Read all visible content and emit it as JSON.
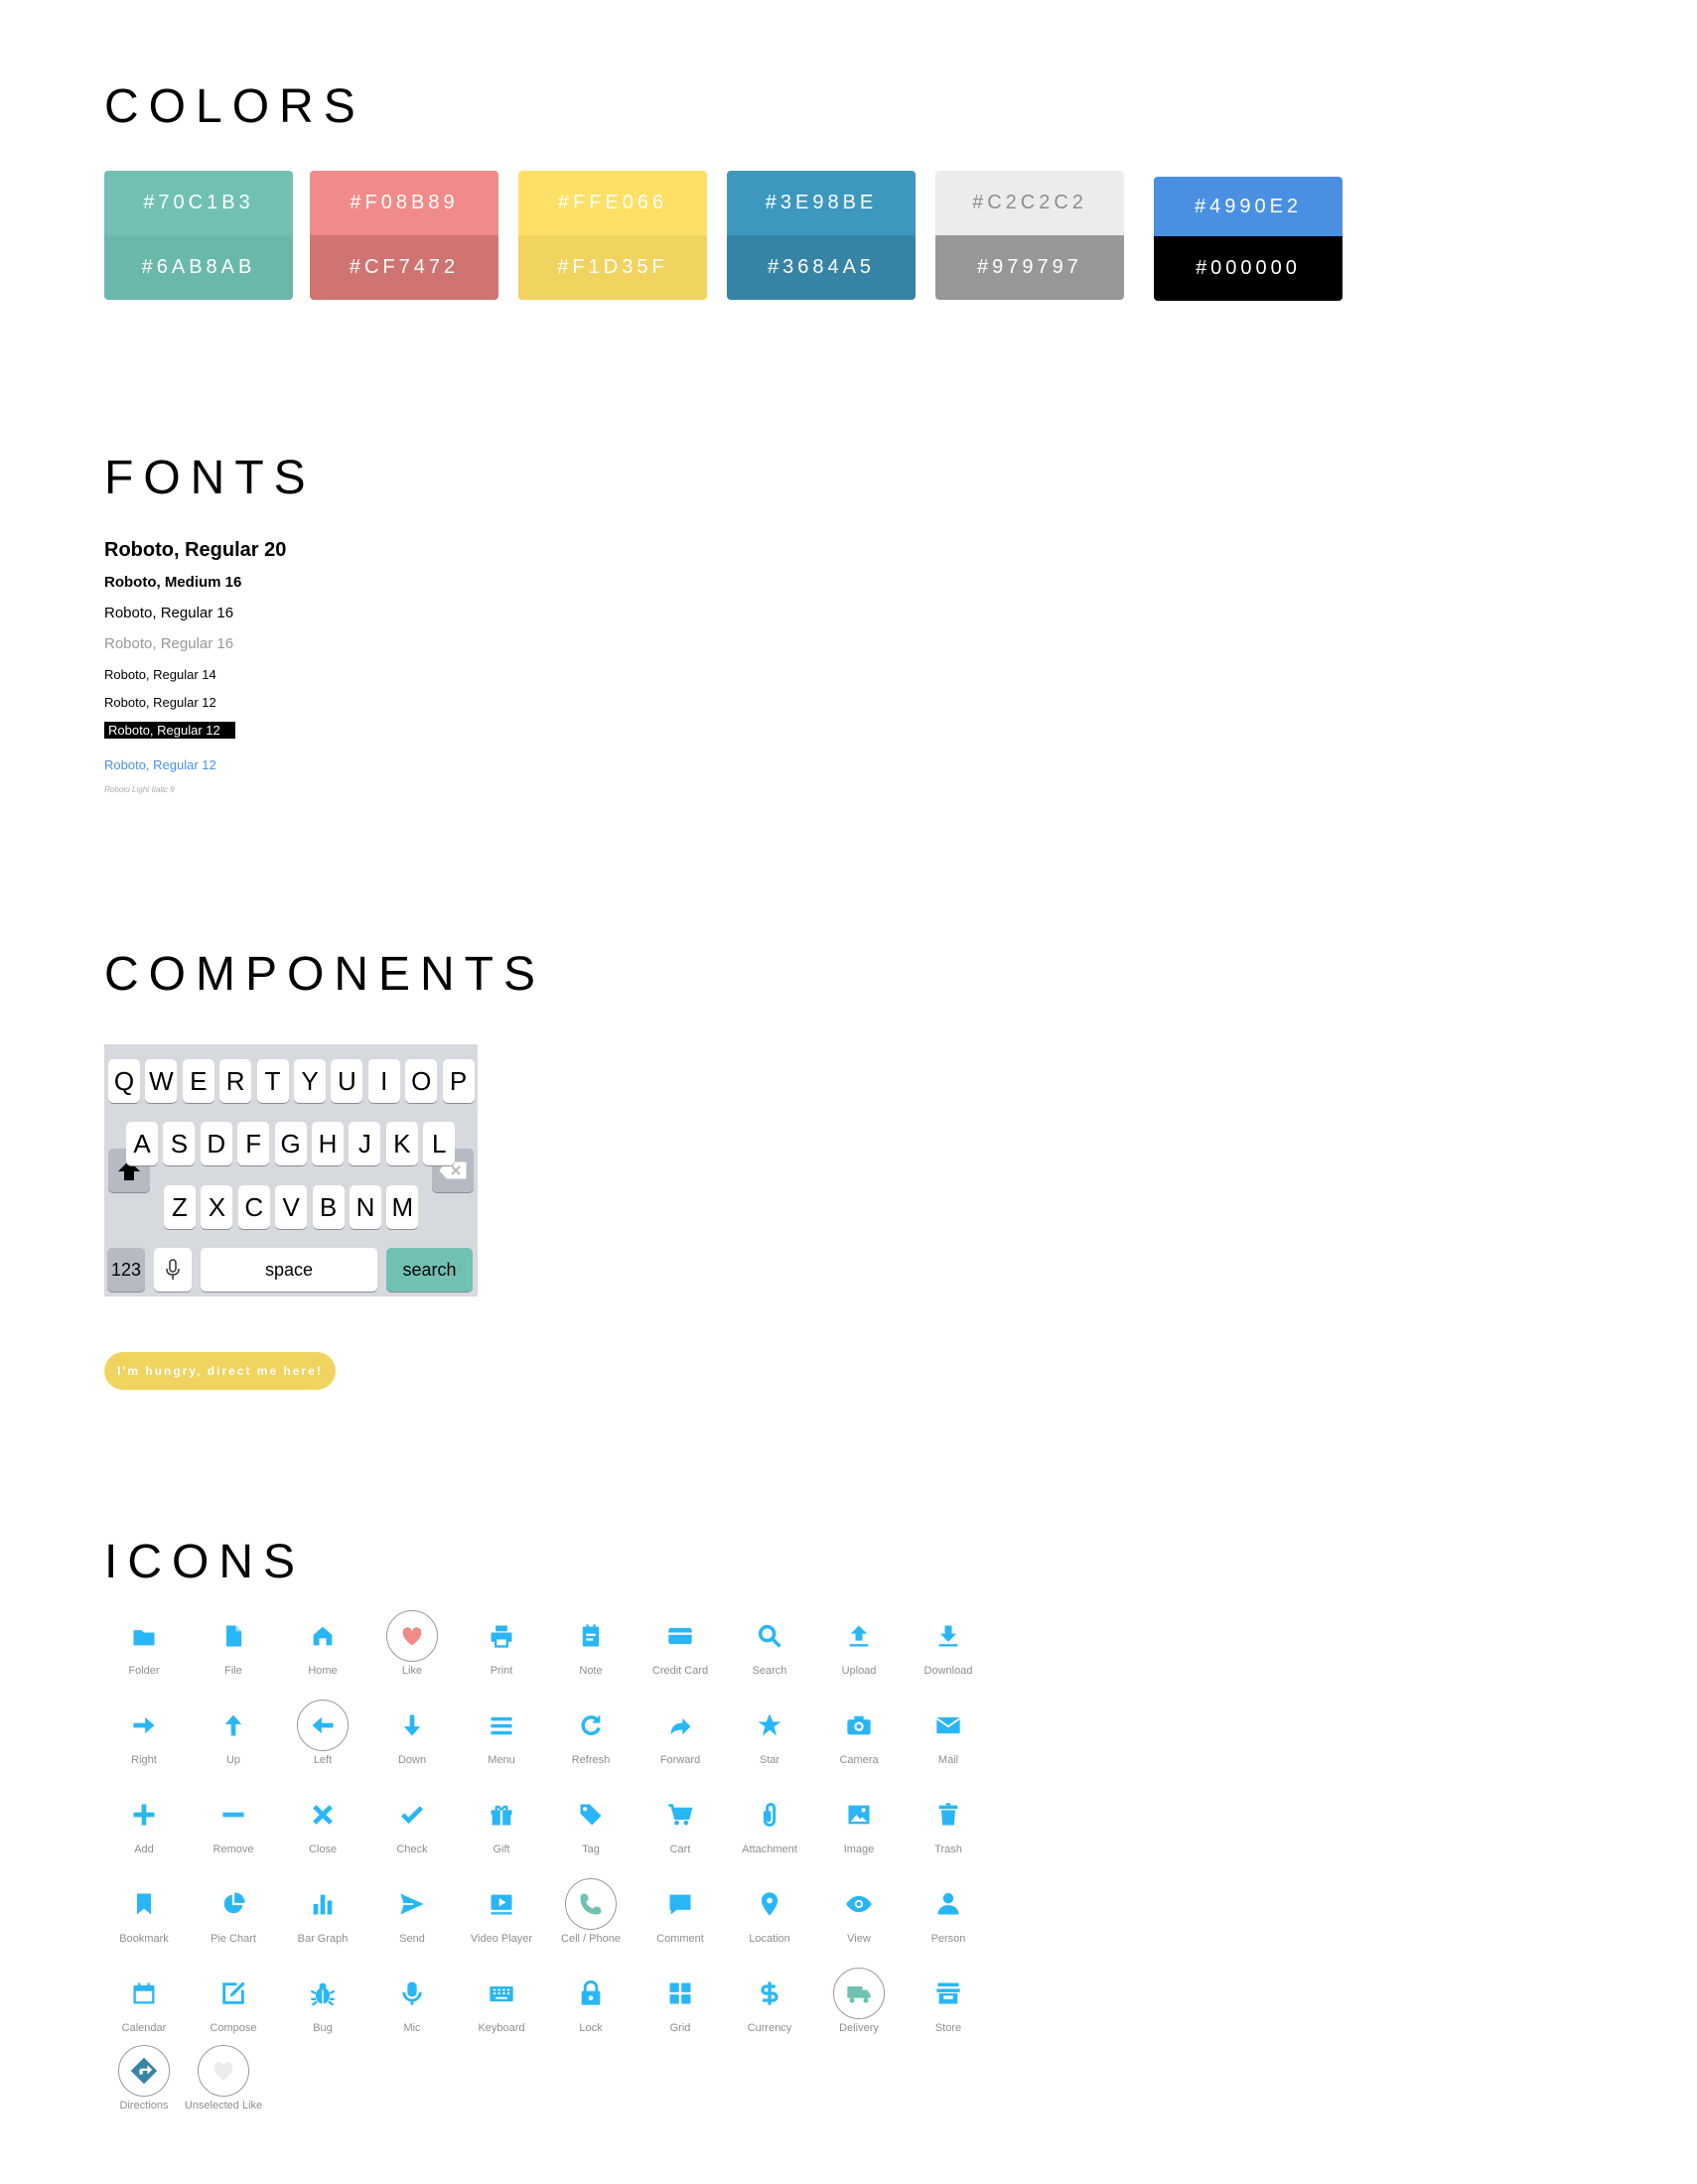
{
  "colors": {
    "title": "COLORS",
    "swatches": [
      {
        "top": "#70C1B3",
        "bottom": "#6AB8AB",
        "top_color": "#70c1b3",
        "bottom_color": "#6ab8ab",
        "top_text_color": "#ffffff"
      },
      {
        "top": "#F08B89",
        "bottom": "#CF7472",
        "top_color": "#f08b89",
        "bottom_color": "#cf7472",
        "top_text_color": "#ffffff"
      },
      {
        "top": "#FFE066",
        "bottom": "#F1D35F",
        "top_color": "#ffe066",
        "bottom_color": "#f1d35f",
        "top_text_color": "#ffffff"
      },
      {
        "top": "#3E98BE",
        "bottom": "#3684A5",
        "top_color": "#3e98be",
        "bottom_color": "#3684a5",
        "top_text_color": "#ffffff"
      },
      {
        "top": "#C2C2C2",
        "bottom": "#979797",
        "top_color": "#ececec",
        "bottom_color": "#979797",
        "top_text_color": "#8e8e8e"
      },
      {
        "top": "#4990E2",
        "bottom": "#000000",
        "top_color": "#4990e2",
        "bottom_color": "#000000",
        "top_text_color": "#ffffff"
      }
    ]
  },
  "fonts": {
    "title": "FONTS",
    "samples": [
      "Roboto, Regular 20",
      "Roboto, Medium 16",
      "Roboto, Regular 16",
      "Roboto, Regular 16",
      "Roboto, Regular 14",
      "Roboto, Regular 12",
      "Roboto, Regular 12",
      "Roboto, Regular 12",
      "Roboto Light Italic 9"
    ]
  },
  "components": {
    "title": "COMPONENTS",
    "keyboard": {
      "row1": [
        "Q",
        "W",
        "E",
        "R",
        "T",
        "Y",
        "U",
        "I",
        "O",
        "P"
      ],
      "row2": [
        "A",
        "S",
        "D",
        "F",
        "G",
        "H",
        "J",
        "K",
        "L"
      ],
      "row3": [
        "Z",
        "X",
        "C",
        "V",
        "B",
        "N",
        "M"
      ],
      "numbers_key": "123",
      "space_key": "space",
      "search_key": "search",
      "search_key_color": "#70c1b3"
    },
    "pill_button": "I'm hungry, direct me here!"
  },
  "icons": {
    "title": "ICONS",
    "accent": "#29b6f6",
    "items": [
      {
        "label": "Folder",
        "icon": "folder-icon"
      },
      {
        "label": "File",
        "icon": "file-icon"
      },
      {
        "label": "Home",
        "icon": "home-icon"
      },
      {
        "label": "Like",
        "icon": "heart-icon"
      },
      {
        "label": "Print",
        "icon": "printer-icon"
      },
      {
        "label": "Note",
        "icon": "note-icon"
      },
      {
        "label": "Credit Card",
        "icon": "credit-card-icon"
      },
      {
        "label": "Search",
        "icon": "search-icon"
      },
      {
        "label": "Upload",
        "icon": "upload-icon"
      },
      {
        "label": "Download",
        "icon": "download-icon"
      },
      {
        "label": "Right",
        "icon": "arrow-right-icon"
      },
      {
        "label": "Up",
        "icon": "arrow-up-icon"
      },
      {
        "label": "Left",
        "icon": "arrow-left-icon"
      },
      {
        "label": "Down",
        "icon": "arrow-down-icon"
      },
      {
        "label": "Menu",
        "icon": "menu-icon"
      },
      {
        "label": "Refresh",
        "icon": "refresh-icon"
      },
      {
        "label": "Forward",
        "icon": "forward-icon"
      },
      {
        "label": "Star",
        "icon": "star-icon"
      },
      {
        "label": "Camera",
        "icon": "camera-icon"
      },
      {
        "label": "Mail",
        "icon": "mail-icon"
      },
      {
        "label": "Add",
        "icon": "plus-icon"
      },
      {
        "label": "Remove",
        "icon": "minus-icon"
      },
      {
        "label": "Close",
        "icon": "close-icon"
      },
      {
        "label": "Check",
        "icon": "check-icon"
      },
      {
        "label": "Gift",
        "icon": "gift-icon"
      },
      {
        "label": "Tag",
        "icon": "tag-icon"
      },
      {
        "label": "Cart",
        "icon": "cart-icon"
      },
      {
        "label": "Attachment",
        "icon": "paperclip-icon"
      },
      {
        "label": "Image",
        "icon": "image-icon"
      },
      {
        "label": "Trash",
        "icon": "trash-icon"
      },
      {
        "label": "Bookmark",
        "icon": "bookmark-icon"
      },
      {
        "label": "Pie Chart",
        "icon": "pie-chart-icon"
      },
      {
        "label": "Bar Graph",
        "icon": "bar-graph-icon"
      },
      {
        "label": "Send",
        "icon": "send-icon"
      },
      {
        "label": "Video Player",
        "icon": "video-player-icon"
      },
      {
        "label": "Cell / Phone",
        "icon": "phone-icon"
      },
      {
        "label": "Comment",
        "icon": "comment-icon"
      },
      {
        "label": "Location",
        "icon": "location-pin-icon"
      },
      {
        "label": "View",
        "icon": "eye-icon"
      },
      {
        "label": "Person",
        "icon": "person-icon"
      },
      {
        "label": "Calendar",
        "icon": "calendar-icon"
      },
      {
        "label": "Compose",
        "icon": "compose-icon"
      },
      {
        "label": "Bug",
        "icon": "bug-icon"
      },
      {
        "label": "Mic",
        "icon": "mic-icon"
      },
      {
        "label": "Keyboard",
        "icon": "keyboard-icon"
      },
      {
        "label": "Lock",
        "icon": "lock-icon"
      },
      {
        "label": "Grid",
        "icon": "grid-icon"
      },
      {
        "label": "Currency",
        "icon": "currency-icon"
      },
      {
        "label": "Delivery",
        "icon": "delivery-truck-icon"
      },
      {
        "label": "Store",
        "icon": "store-icon"
      },
      {
        "label": "Directions",
        "icon": "directions-icon"
      },
      {
        "label": "Unselected Like",
        "icon": "heart-outline-icon"
      }
    ]
  }
}
